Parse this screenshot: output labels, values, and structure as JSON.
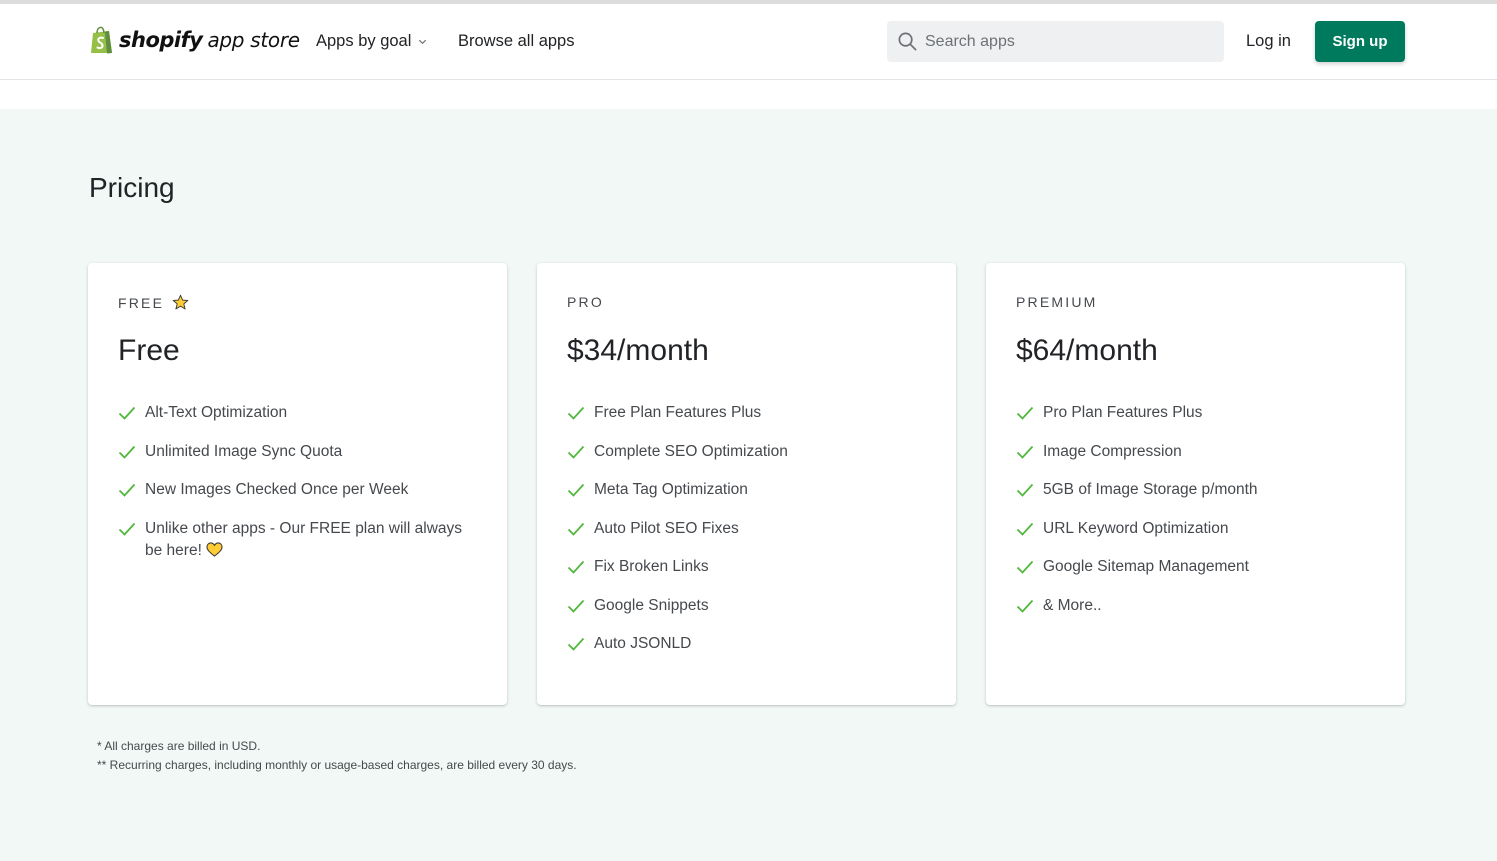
{
  "header": {
    "logo_word": "shopify",
    "logo_sub": "app store",
    "nav": {
      "apps_by_goal": "Apps by goal",
      "browse_all": "Browse all apps"
    },
    "search": {
      "placeholder": "Search apps",
      "value": ""
    },
    "login": "Log in",
    "signup": "Sign up",
    "accent_color": "#007a5c"
  },
  "pricing": {
    "title": "Pricing",
    "plans": [
      {
        "tier": "FREE",
        "tier_icon": "star-icon",
        "price": "Free",
        "features": [
          "Alt-Text Optimization",
          "Unlimited Image Sync Quota",
          "New Images Checked Once per Week",
          "Unlike other apps - Our FREE plan will always be here!"
        ],
        "last_feature_icon": "yellow-heart-icon"
      },
      {
        "tier": "PRO",
        "price": "$34/month",
        "features": [
          "Free Plan Features Plus",
          "Complete SEO Optimization",
          "Meta Tag Optimization",
          "Auto Pilot SEO Fixes",
          "Fix Broken Links",
          "Google Snippets",
          "Auto JSONLD"
        ]
      },
      {
        "tier": "PREMIUM",
        "price": "$64/month",
        "features": [
          "Pro Plan Features Plus",
          "Image Compression",
          "5GB of Image Storage p/month",
          "URL Keyword Optimization",
          "Google Sitemap Management",
          "& More.."
        ]
      }
    ],
    "footnotes": [
      "* All charges are billed in USD.",
      "** Recurring charges, including monthly or usage-based charges, are billed every 30 days."
    ]
  }
}
